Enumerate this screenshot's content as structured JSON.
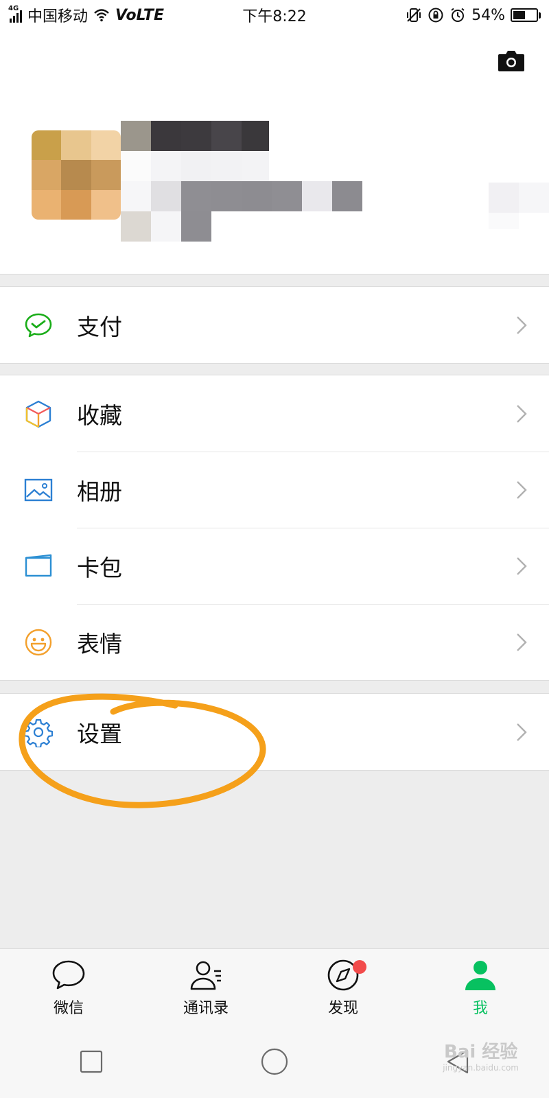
{
  "status_bar": {
    "network_type": "4G",
    "carrier": "中国移动",
    "volte": "VoLTE",
    "time": "下午8:22",
    "battery_percent": "54%",
    "battery_level": 0.54,
    "icons": [
      "signal-icon",
      "wifi-icon",
      "vibrate-icon",
      "rotation-lock-icon",
      "alarm-icon",
      "battery-icon"
    ]
  },
  "profile": {
    "camera_icon": "camera-icon",
    "avatar_icon": "avatar-pixelated",
    "name_redacted": true
  },
  "menu_groups": [
    [
      {
        "label": "支付",
        "icon": "pay-icon",
        "color": "#1aad19"
      }
    ],
    [
      {
        "label": "收藏",
        "icon": "favorites-cube-icon",
        "color": "#f3a02c"
      },
      {
        "label": "相册",
        "icon": "album-icon",
        "color": "#2b7fd3"
      },
      {
        "label": "卡包",
        "icon": "card-wallet-icon",
        "color": "#2b8fd3"
      },
      {
        "label": "表情",
        "icon": "emoji-smile-icon",
        "color": "#f3a02c"
      }
    ],
    [
      {
        "label": "设置",
        "icon": "gear-icon",
        "color": "#2b7fd3"
      }
    ]
  ],
  "tabs": [
    {
      "label": "微信",
      "icon": "chat-bubble-icon",
      "active": false
    },
    {
      "label": "通讯录",
      "icon": "contacts-icon",
      "active": false
    },
    {
      "label": "发现",
      "icon": "compass-icon",
      "active": false,
      "badge": "red-dot"
    },
    {
      "label": "我",
      "icon": "me-person-icon",
      "active": true
    }
  ],
  "system_nav": [
    "recent-apps-icon",
    "home-icon",
    "back-icon"
  ],
  "watermark": {
    "brand": "Bai  经验",
    "url": "jingyan.baidu.com"
  },
  "colors": {
    "accent_green": "#07c160",
    "annotation_orange": "#f5a01a",
    "background": "#ededed"
  }
}
